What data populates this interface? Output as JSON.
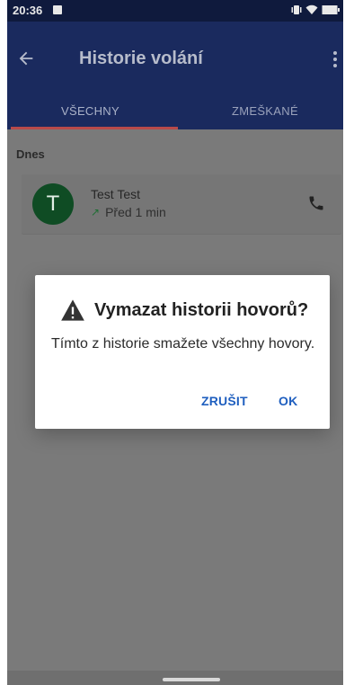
{
  "status_bar": {
    "time": "20:36"
  },
  "app_bar": {
    "title": "Historie volání",
    "back_icon": "arrow-left-icon",
    "menu_icon": "more-vert-icon"
  },
  "tabs": [
    {
      "label": "VŠECHNY"
    },
    {
      "label": "ZMEŠKANÉ"
    }
  ],
  "content": {
    "section_label": "Dnes",
    "call_item": {
      "avatar_letter": "T",
      "name": "Test Test",
      "time": "Před 1 min",
      "direction_icon": "outgoing-arrow-icon",
      "call_icon": "phone-icon"
    }
  },
  "dialog": {
    "title": "Vymazat historii hovorů?",
    "message": "Tímto z historie smažete všechny hovory.",
    "cancel_label": "ZRUŠIT",
    "ok_label": "OK",
    "warning_icon": "warning-icon"
  },
  "colors": {
    "app_bar_bg": "#1a2a5e",
    "tab_indicator": "#b84a4a",
    "avatar_bg": "#0f4c24",
    "dialog_button": "#1f5fbf"
  }
}
